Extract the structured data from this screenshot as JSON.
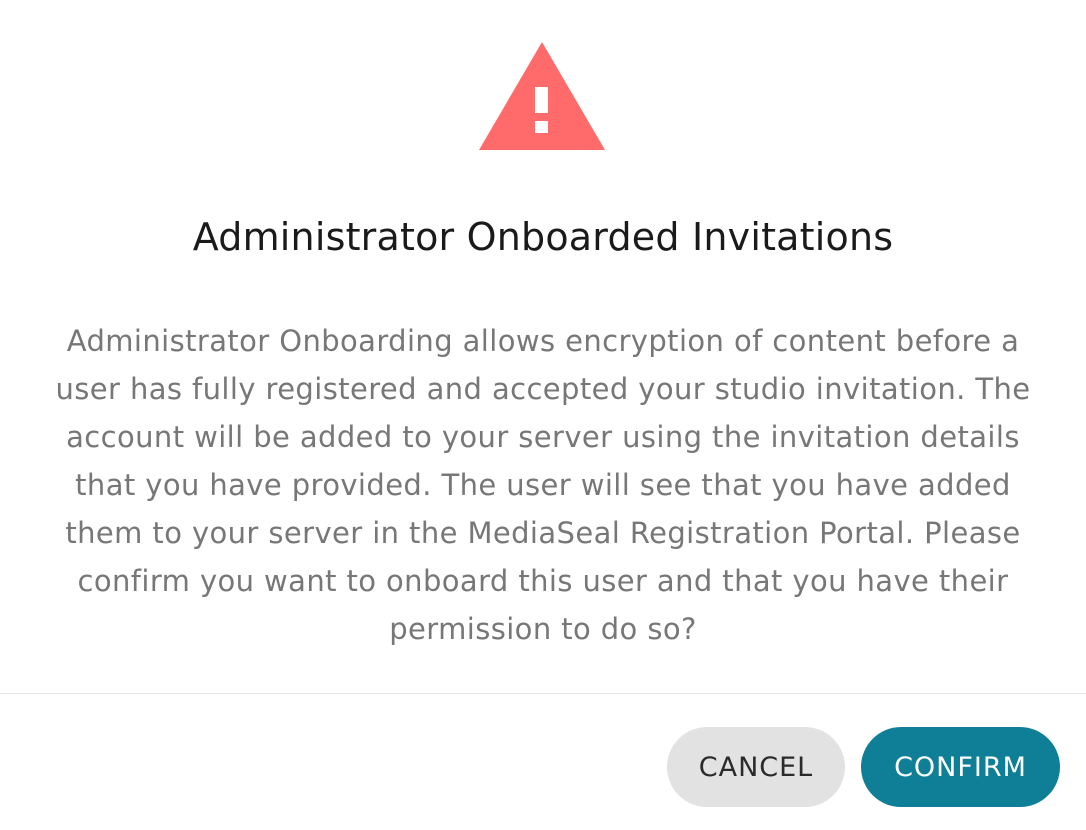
{
  "dialog": {
    "icon": "warning-triangle-icon",
    "icon_color": "#ff6b6b",
    "title": "Administrator Onboarded Invitations",
    "body": "Administrator Onboarding allows encryption of content before a user has fully registered and accepted your studio invitation. The account will be added to your server using the invitation details that you have provided. The user will see that you have added them to your server in the MediaSeal Registration Portal. Please confirm you want to onboard this user and that you have their permission to do so?",
    "actions": {
      "cancel_label": "CANCEL",
      "confirm_label": "CONFIRM"
    },
    "colors": {
      "confirm_background": "#0e7f97",
      "cancel_background": "#e2e2e2"
    }
  }
}
